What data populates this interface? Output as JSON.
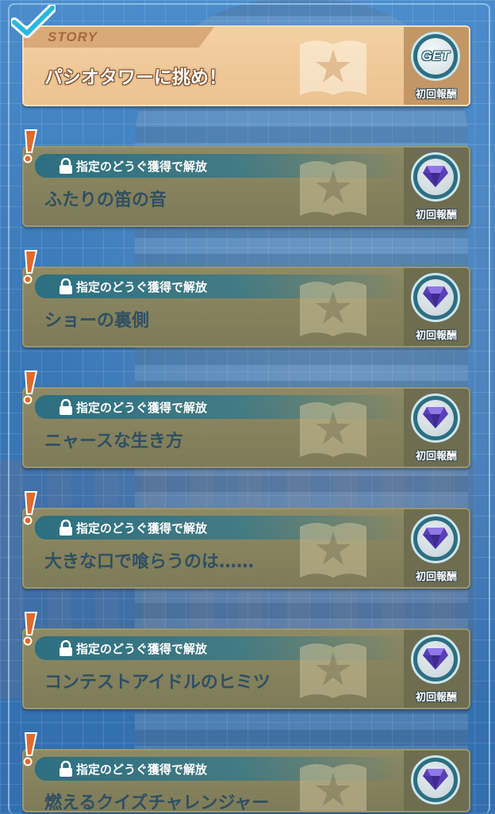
{
  "story_tag": "STORY",
  "get_label": "GET",
  "lock_text": "指定のどうぐ獲得で解放",
  "reward_label": "初回報酬",
  "stories": [
    {
      "title": "パシオタワーに挑め！",
      "status": "unlocked",
      "reward": "get"
    },
    {
      "title": "ふたりの笛の音",
      "status": "locked",
      "reward": "gem"
    },
    {
      "title": "ショーの裏側",
      "status": "locked",
      "reward": "gem"
    },
    {
      "title": "ニャースな生き方",
      "status": "locked",
      "reward": "gem"
    },
    {
      "title": "大きな口で喰らうのは……",
      "status": "locked",
      "reward": "gem"
    },
    {
      "title": "コンテストアイドルのヒミツ",
      "status": "locked",
      "reward": "gem"
    },
    {
      "title": "燃えるクイズチャレンジャー",
      "status": "locked",
      "reward": "gem"
    }
  ],
  "colors": {
    "background": "#3b79b8",
    "unlocked_card": "#f3d0a3",
    "locked_card": "#8e8a64",
    "lock_bar": "#2d6e82",
    "alert": "#e06a2c",
    "check": "#28b8e0"
  }
}
